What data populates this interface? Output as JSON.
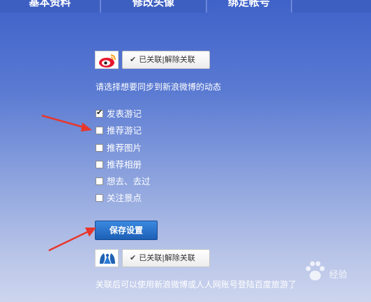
{
  "tabs": [
    {
      "label": "基本资料"
    },
    {
      "label": "修改头像"
    },
    {
      "label": "绑定帐号"
    },
    {
      "label": ""
    }
  ],
  "weibo_account": {
    "logo_icon": "sina-weibo-icon",
    "status_label": "已关联|解除关联"
  },
  "sync_prompt": "请选择想要同步到新浪微博的动态",
  "sync_options": [
    {
      "label": "发表游记",
      "checked": true
    },
    {
      "label": "推荐游记",
      "checked": false
    },
    {
      "label": "推荐图片",
      "checked": false
    },
    {
      "label": "推荐相册",
      "checked": false
    },
    {
      "label": "想去、去过",
      "checked": false
    },
    {
      "label": "关注景点",
      "checked": false
    }
  ],
  "save_button": "保存设置",
  "renren_account": {
    "logo_icon": "renren-icon",
    "status_label": "已关联|解除关联"
  },
  "footnote": "关联后可以使用新浪微博或人人网账号登陆百度旅游了",
  "watermark": "经验",
  "colors": {
    "background_top": "#3f62c9",
    "background_bottom": "#cdd5ee",
    "save_button": "#2a74cf",
    "arrow": "#e8372c"
  }
}
